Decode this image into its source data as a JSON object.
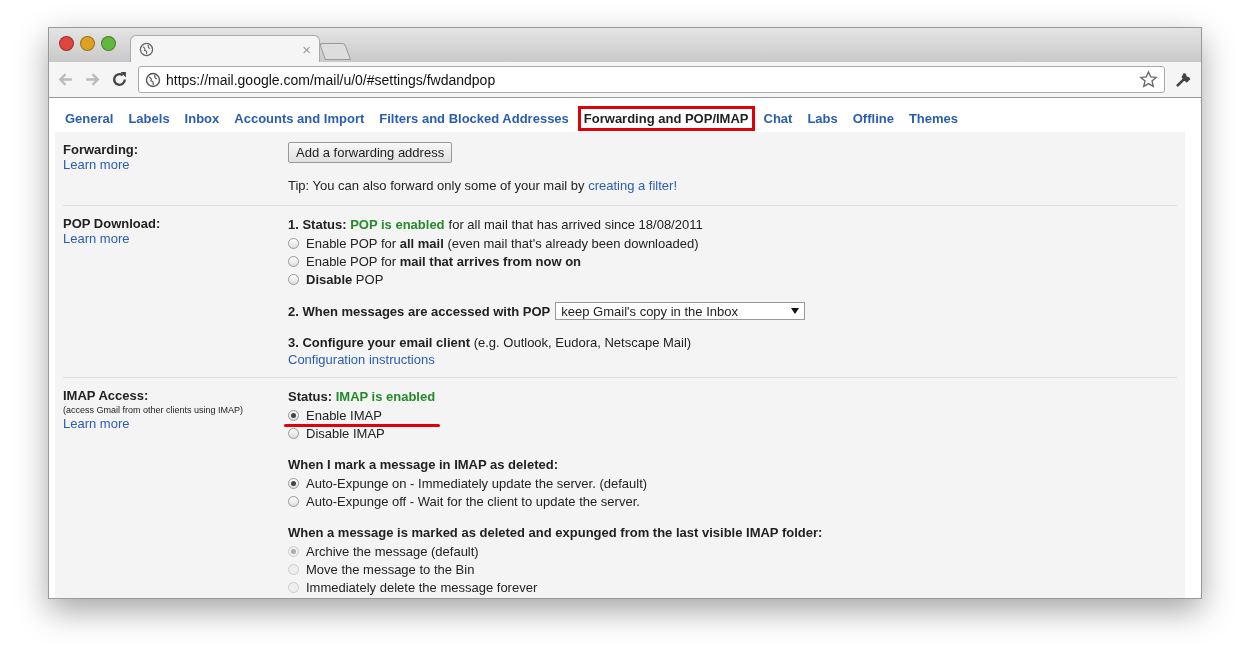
{
  "browser": {
    "tab_close": "×",
    "url": "https://mail.google.com/mail/u/0/#settings/fwdandpop"
  },
  "tabs": [
    {
      "label": "General",
      "selected": false,
      "highlighted": false
    },
    {
      "label": "Labels",
      "selected": false,
      "highlighted": false
    },
    {
      "label": "Inbox",
      "selected": false,
      "highlighted": false
    },
    {
      "label": "Accounts and Import",
      "selected": false,
      "highlighted": false
    },
    {
      "label": "Filters and Blocked Addresses",
      "selected": false,
      "highlighted": false
    },
    {
      "label": "Forwarding and POP/IMAP",
      "selected": true,
      "highlighted": true
    },
    {
      "label": "Chat",
      "selected": false,
      "highlighted": false
    },
    {
      "label": "Labs",
      "selected": false,
      "highlighted": false
    },
    {
      "label": "Offline",
      "selected": false,
      "highlighted": false
    },
    {
      "label": "Themes",
      "selected": false,
      "highlighted": false
    }
  ],
  "sections": [
    {
      "title": "Forwarding:",
      "link": "Learn more",
      "blocks": [
        {
          "kind": "button",
          "label": "Add a forwarding address"
        },
        {
          "kind": "tip",
          "text": "Tip: You can also forward only some of your mail by",
          "link": "creating a filter!"
        }
      ]
    },
    {
      "title": "POP Download:",
      "link": "Learn more",
      "blocks": [
        {
          "kind": "radios",
          "status": {
            "label": "1. Status:",
            "value": "POP is enabled",
            "rest": "for all mail that has arrived since 18/08/2011"
          },
          "options": [
            {
              "label": "Enable POP for **all mail** (even mail that's already been downloaded)",
              "selected": false,
              "disabled": false,
              "underlined": false
            },
            {
              "label": "Enable POP for **mail that arrives from now on**",
              "selected": false,
              "disabled": false,
              "underlined": false
            },
            {
              "label": "**Disable** POP",
              "selected": false,
              "disabled": false,
              "underlined": false
            }
          ]
        },
        {
          "kind": "select",
          "label": "2. When messages are accessed with POP",
          "value": "keep Gmail's copy in the Inbox"
        },
        {
          "kind": "configure",
          "text": "**3. Configure your email client** (e.g. Outlook, Eudora, Netscape Mail)",
          "link": "Configuration instructions"
        }
      ]
    },
    {
      "title": "IMAP Access:",
      "note": "(access Gmail from other clients using IMAP)",
      "link": "Learn more",
      "blocks": [
        {
          "kind": "radios",
          "status": {
            "label": "Status:",
            "value": "IMAP is enabled"
          },
          "options": [
            {
              "label": "Enable IMAP",
              "selected": true,
              "disabled": false,
              "underlined": true
            },
            {
              "label": "Disable IMAP",
              "selected": false,
              "disabled": false,
              "underlined": false
            }
          ]
        },
        {
          "kind": "radios",
          "heading": "When I mark a message in IMAP as deleted:",
          "options": [
            {
              "label": "Auto-Expunge on - Immediately update the server. (default)",
              "selected": true,
              "disabled": false,
              "underlined": false
            },
            {
              "label": "Auto-Expunge off - Wait for the client to update the server.",
              "selected": false,
              "disabled": false,
              "underlined": false
            }
          ]
        },
        {
          "kind": "radios",
          "heading": "When a message is marked as deleted and expunged from the last visible IMAP folder:",
          "options": [
            {
              "label": "Archive the message (default)",
              "selected": true,
              "disabled": true,
              "underlined": false
            },
            {
              "label": "Move the message to the Bin",
              "selected": false,
              "disabled": true,
              "underlined": false
            },
            {
              "label": "Immediately delete the message forever",
              "selected": false,
              "disabled": true,
              "underlined": false
            }
          ]
        }
      ]
    }
  ]
}
